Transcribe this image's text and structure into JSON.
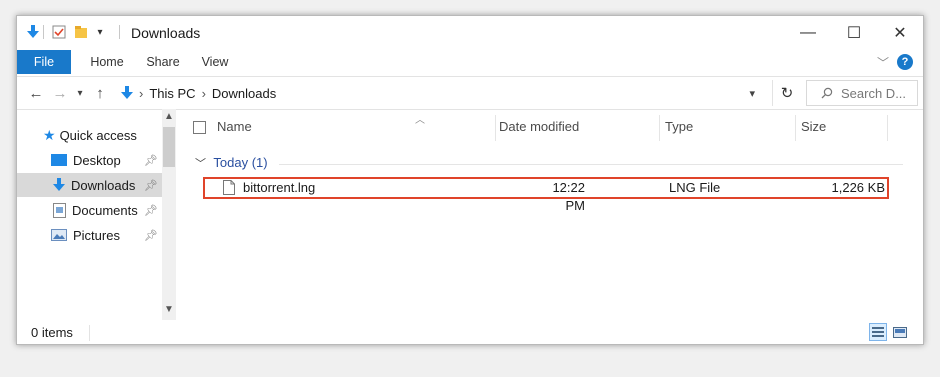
{
  "window": {
    "title": "Downloads",
    "controls": {
      "minimize": "—",
      "maximize": "☐",
      "close": "✕"
    }
  },
  "ribbon": {
    "tabs": [
      {
        "label": "File"
      },
      {
        "label": "Home"
      },
      {
        "label": "Share"
      },
      {
        "label": "View"
      }
    ],
    "collapse_icon": "chevron-down-icon",
    "help_label": "?"
  },
  "navigation": {
    "back_icon": "back-arrow-icon",
    "forward_icon": "forward-arrow-icon",
    "recent_icon": "chevron-down-icon",
    "up_icon": "up-arrow-icon",
    "breadcrumb": [
      "This PC",
      "Downloads"
    ],
    "separator": "›",
    "refresh_icon": "refresh-icon",
    "search_placeholder": "Search D..."
  },
  "sidebar": {
    "items": [
      {
        "label": "Quick access",
        "icon": "star-icon",
        "pinned": false
      },
      {
        "label": "Desktop",
        "icon": "desktop-icon",
        "pinned": true
      },
      {
        "label": "Downloads",
        "icon": "download-arrow-icon",
        "pinned": true,
        "selected": true
      },
      {
        "label": "Documents",
        "icon": "documents-icon",
        "pinned": true
      },
      {
        "label": "Pictures",
        "icon": "pictures-icon",
        "pinned": true
      }
    ]
  },
  "columns": {
    "name": "Name",
    "date_modified": "Date modified",
    "type": "Type",
    "size": "Size"
  },
  "group": {
    "label": "Today (1)"
  },
  "files": [
    {
      "name": "bittorrent.lng",
      "date_modified": "12:22 PM",
      "type": "LNG File",
      "size": "1,226 KB"
    }
  ],
  "status": {
    "items_text": "0 items"
  },
  "colors": {
    "accent": "#1979ca",
    "highlight_border": "#e0442a",
    "selected_bg": "#d9d9d9"
  }
}
